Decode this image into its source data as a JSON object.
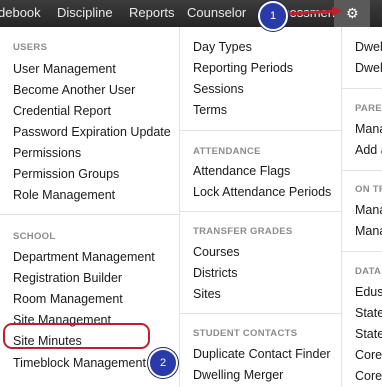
{
  "nav": {
    "items": [
      "debook",
      "Discipline",
      "Reports",
      "Counselor",
      "sessment"
    ],
    "settings_icon": "gear-icon"
  },
  "columns": {
    "col1": {
      "sections": [
        {
          "title": "USERS",
          "items": [
            "User Management",
            "Become Another User",
            "Credential Report",
            "Password Expiration Update",
            "Permissions",
            "Permission Groups",
            "Role Management"
          ]
        },
        {
          "title": "SCHOOL",
          "items": [
            "Department Management",
            "Registration Builder",
            "Room Management",
            "Site Management",
            "Site Minutes",
            "Timeblock Management"
          ]
        }
      ]
    },
    "col2": {
      "top_items": [
        "Day Types",
        "Reporting Periods",
        "Sessions",
        "Terms"
      ],
      "sections": [
        {
          "title": "ATTENDANCE",
          "items": [
            "Attendance Flags",
            "Lock Attendance Periods"
          ]
        },
        {
          "title": "TRANSFER GRADES",
          "items": [
            "Courses",
            "Districts",
            "Sites"
          ]
        },
        {
          "title": "STUDENT CONTACTS",
          "items": [
            "Duplicate Contact Finder",
            "Dwelling Merger"
          ]
        }
      ]
    },
    "col3": {
      "top_items": [
        "Dwell",
        "Dwell"
      ],
      "sections": [
        {
          "title": "PARE",
          "items": [
            "Mana",
            "Add a"
          ]
        },
        {
          "title": "ON TR",
          "items": [
            "Mana",
            "Mana"
          ]
        },
        {
          "title": "DATA",
          "items": [
            "Edus",
            "State",
            "State",
            "Core",
            "Core"
          ]
        }
      ]
    }
  },
  "annotations": {
    "step1": "1",
    "step2": "2",
    "highlight_color": "#c0202a",
    "badge_color": "#2a3aa8"
  }
}
